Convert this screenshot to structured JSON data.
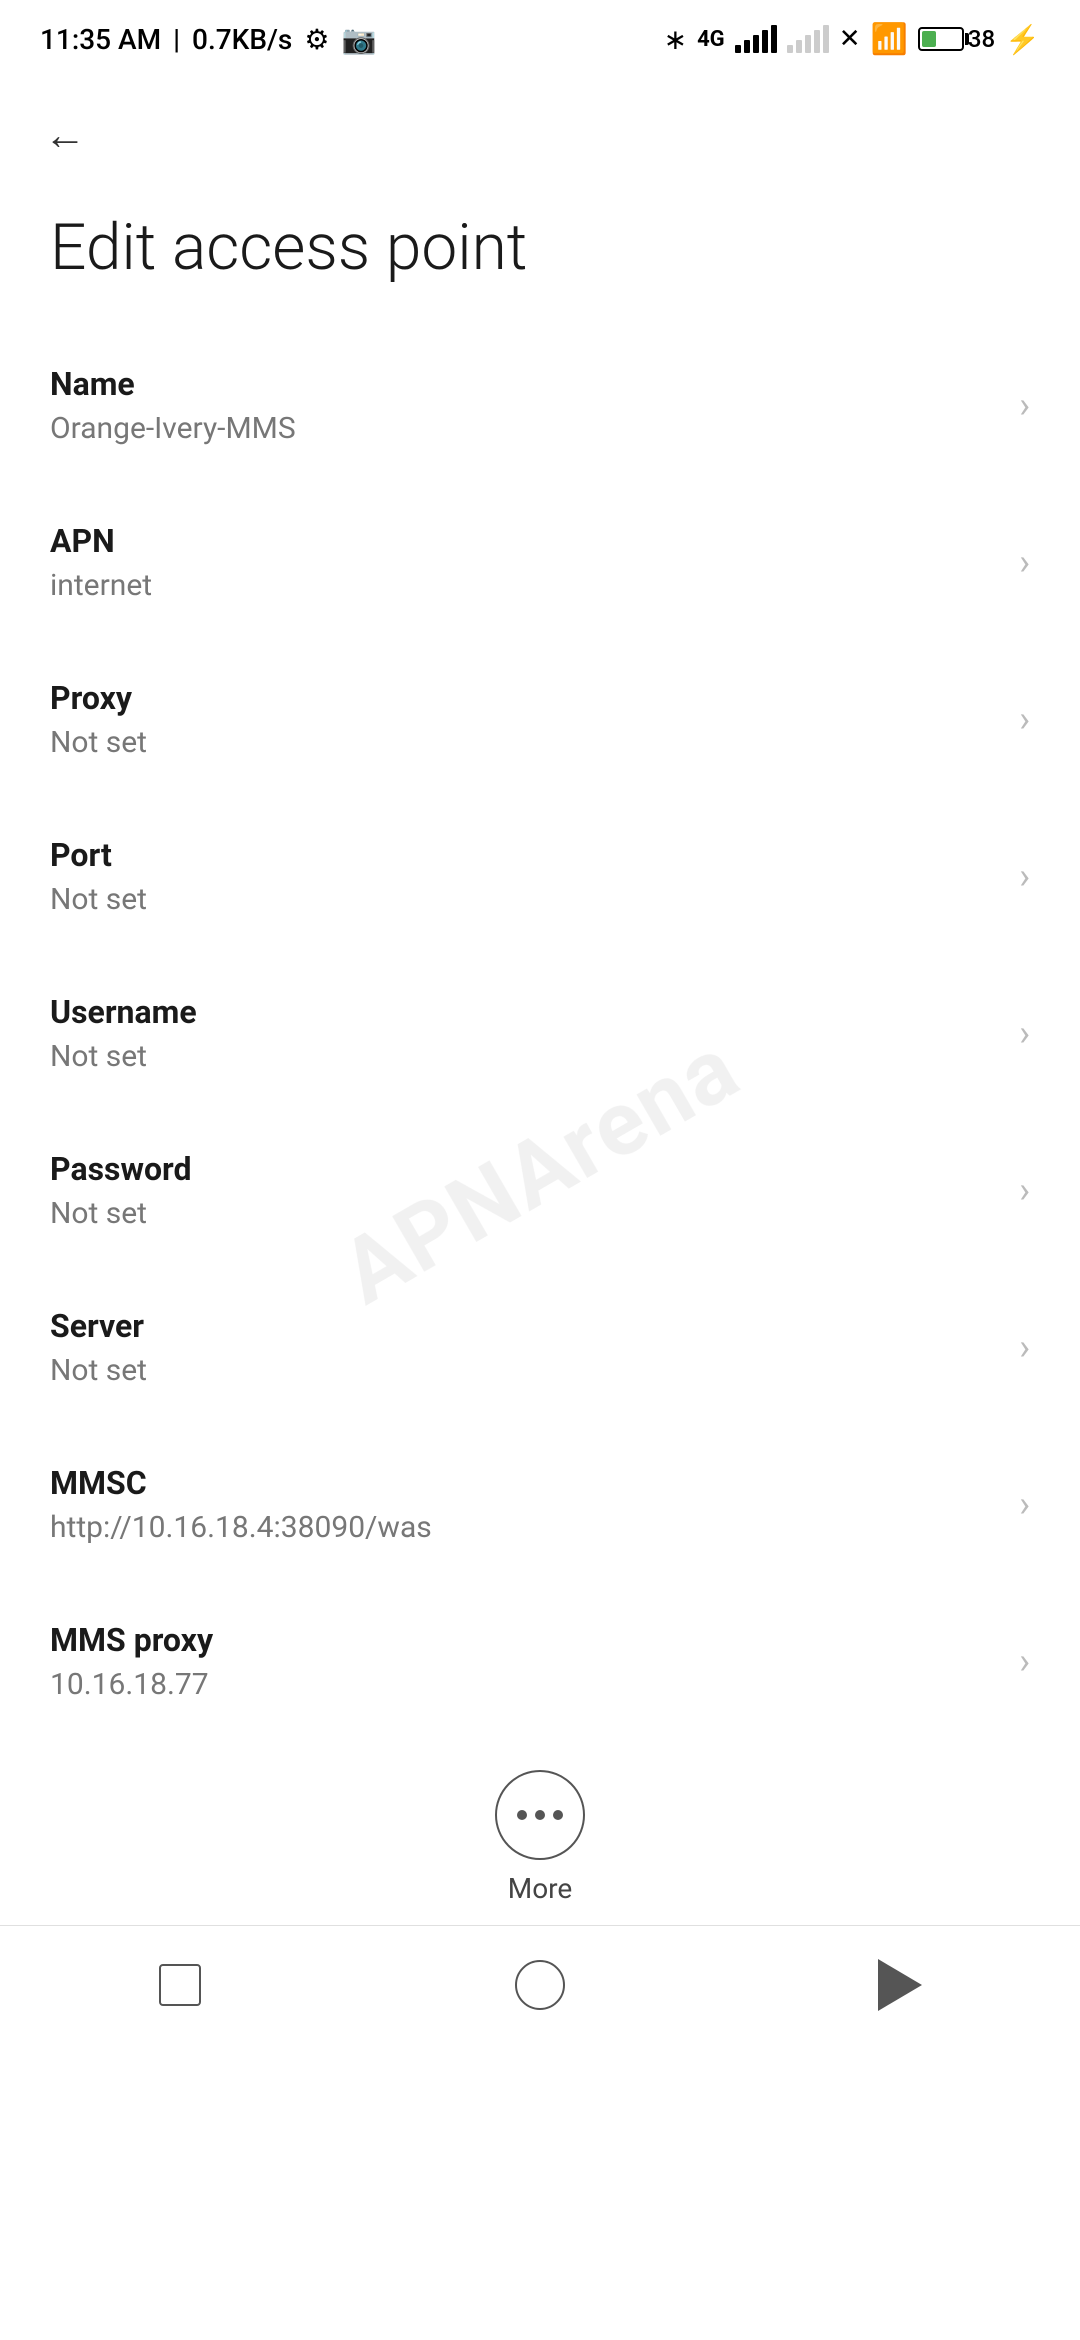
{
  "statusBar": {
    "time": "11:35 AM",
    "speed": "0.7KB/s",
    "batteryPercent": 38
  },
  "header": {
    "backLabel": "←",
    "title": "Edit access point"
  },
  "settings": {
    "items": [
      {
        "label": "Name",
        "value": "Orange-Ivery-MMS"
      },
      {
        "label": "APN",
        "value": "internet"
      },
      {
        "label": "Proxy",
        "value": "Not set"
      },
      {
        "label": "Port",
        "value": "Not set"
      },
      {
        "label": "Username",
        "value": "Not set"
      },
      {
        "label": "Password",
        "value": "Not set"
      },
      {
        "label": "Server",
        "value": "Not set"
      },
      {
        "label": "MMSC",
        "value": "http://10.16.18.4:38090/was"
      },
      {
        "label": "MMS proxy",
        "value": "10.16.18.77"
      }
    ]
  },
  "more": {
    "label": "More"
  },
  "watermark": "APNArena"
}
